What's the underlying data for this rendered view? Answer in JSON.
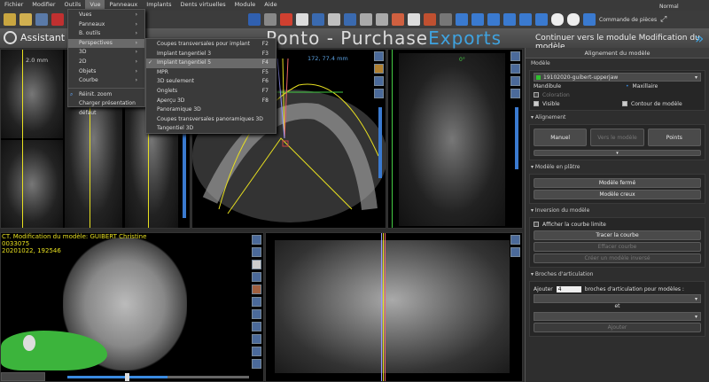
{
  "menubar": [
    "Fichier",
    "Modifier",
    "Outils",
    "Vue",
    "Panneaux",
    "Implants",
    "Dents virtuelles",
    "Module",
    "Aide"
  ],
  "toolbar": {
    "order_parts": "Commande de pièces",
    "view_mode": "Normal"
  },
  "titlebar": {
    "left": "Assistant de c",
    "brand_a": "Ponto - Purchase",
    "brand_b": "Exports",
    "right": "Continuer vers le module Modification du modèle"
  },
  "vue_menu": {
    "items": [
      "Vues",
      "Panneaux",
      "B. outils",
      "Perspectives",
      "3D",
      "2D",
      "Objets",
      "Courbe"
    ],
    "extra": [
      "Réinit. zoom",
      "Charger présentation défaut"
    ]
  },
  "perspectives_menu": [
    {
      "label": "Coupes transversales pour implant",
      "key": "F2"
    },
    {
      "label": "Implant tangentiel 3",
      "key": "F3"
    },
    {
      "label": "Implant tangentiel 5",
      "key": "F4",
      "checked": true
    },
    {
      "label": "MPR",
      "key": "F5"
    },
    {
      "label": "3D seulement",
      "key": "F6"
    },
    {
      "label": "Onglets",
      "key": "F7"
    },
    {
      "label": "Aperçu 3D",
      "key": "F8"
    },
    {
      "label": "Panoramique 3D",
      "key": ""
    },
    {
      "label": "Coupes transversales panoramiques 3D",
      "key": ""
    },
    {
      "label": "Tangentiel 3D",
      "key": ""
    }
  ],
  "views": {
    "cross_mm": "2.0 mm",
    "axial_coord": "172, 77.4 mm",
    "coronal_angle": "0°",
    "info_line1": "CT. Modification du modèle: GUIBERT Christine",
    "info_line2": "0033075",
    "info_line3": "20201022, 192546",
    "slider_value": 0.55
  },
  "panel": {
    "title": "Alignement du modèle",
    "model_label": "Modèle",
    "model_value": "19102020-guibert-upperjaw",
    "model_color": "#2fc02f",
    "mandibule": "Mandibule",
    "maxillaire": "Maxillaire",
    "coloration": "Coloration",
    "visible": "Visible",
    "contour": "Contour de modèle",
    "alignement": "Alignement",
    "manuel": "Manuel",
    "vers_modele": "Vers le modèle",
    "points": "Points",
    "platre": "Modèle en plâtre",
    "ferme": "Modèle fermé",
    "creux": "Modèle creux",
    "inversion": "Inversion du modèle",
    "afficher": "Afficher la courbe limite",
    "tracer": "Tracer la courbe",
    "effacer": "Effacer courbe",
    "creer": "Créer un modèle inversé",
    "broches": "Broches d'articulation",
    "ajouter_label": "Ajouter",
    "ajouter_value": "4",
    "broches_text": "broches d'articulation pour modèles :",
    "et": "et",
    "ajouter_btn": "Ajouter"
  }
}
